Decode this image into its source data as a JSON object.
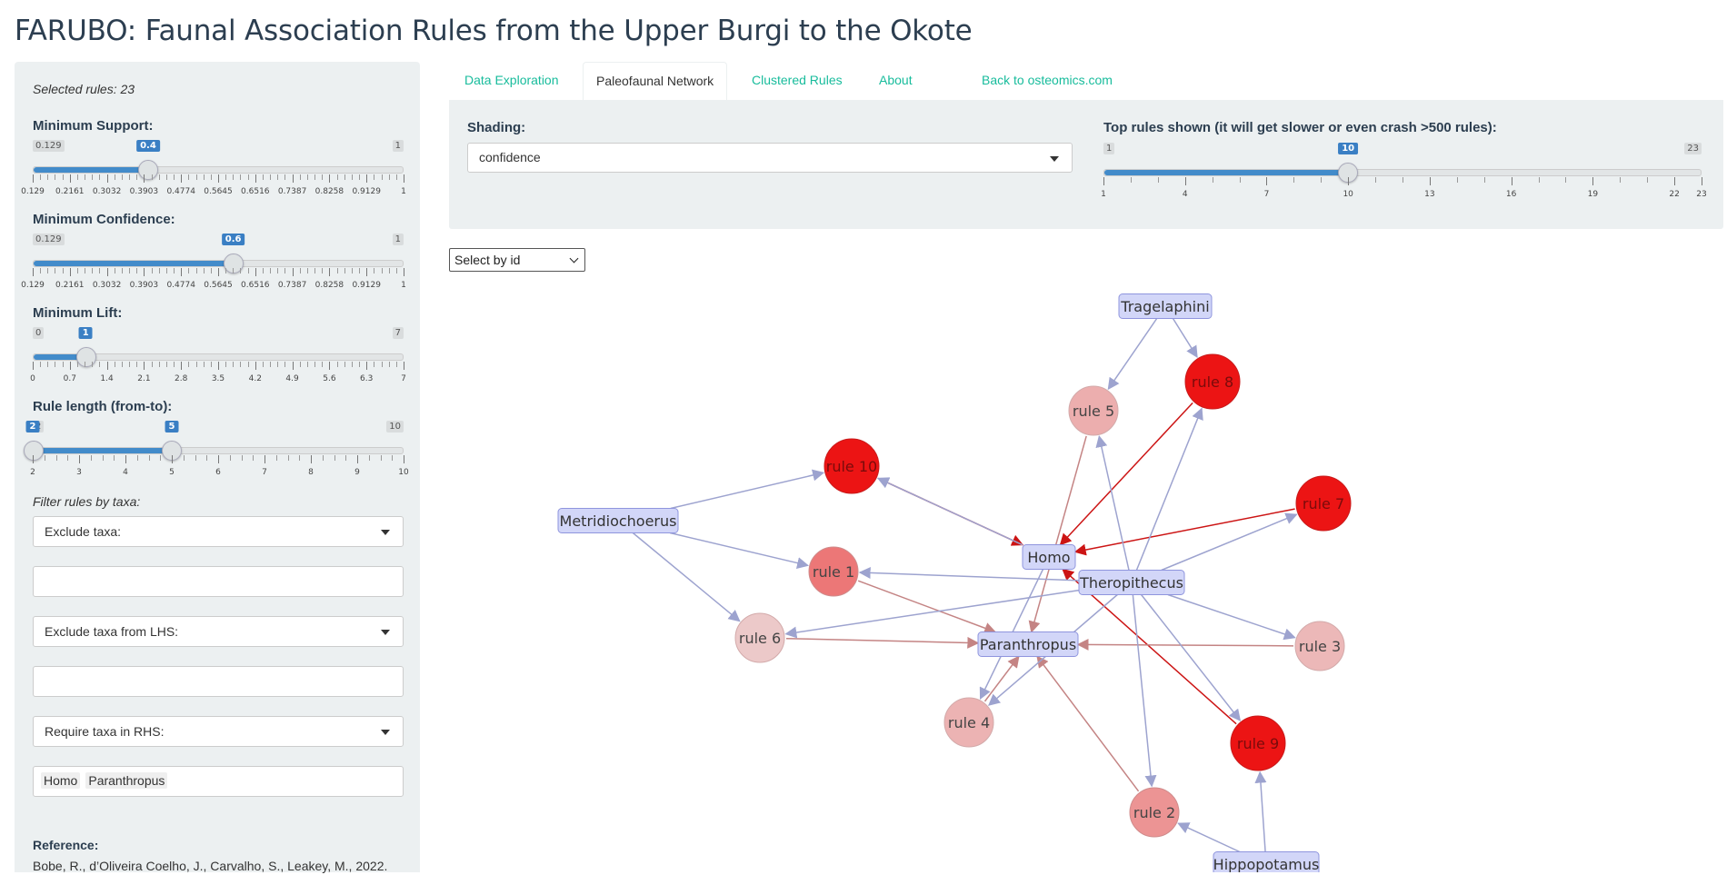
{
  "app_title": "FARUBO: Faunal Association Rules from the Upper Burgi to the Okote",
  "sidebar": {
    "selected_rules": "Selected rules: 23",
    "sliders": {
      "support": {
        "label": "Minimum Support:",
        "min_label": "0.129",
        "max_label": "1",
        "value_label": "0.4",
        "min": 0.129,
        "max": 1,
        "value": 0.4,
        "ticks": [
          "0.129",
          "0.2161",
          "0.3032",
          "0.3903",
          "0.4774",
          "0.5645",
          "0.6516",
          "0.7387",
          "0.8258",
          "0.9129",
          "1"
        ]
      },
      "confidence": {
        "label": "Minimum Confidence:",
        "min_label": "0.129",
        "max_label": "1",
        "value_label": "0.6",
        "min": 0.129,
        "max": 1,
        "value": 0.6,
        "ticks": [
          "0.129",
          "0.2161",
          "0.3032",
          "0.3903",
          "0.4774",
          "0.5645",
          "0.6516",
          "0.7387",
          "0.8258",
          "0.9129",
          "1"
        ]
      },
      "lift": {
        "label": "Minimum Lift:",
        "min_label": "0",
        "max_label": "7",
        "value_label": "1",
        "min": 0,
        "max": 7,
        "value": 1,
        "ticks": [
          "0",
          "0.7",
          "1.4",
          "2.1",
          "2.8",
          "3.5",
          "4.2",
          "4.9",
          "5.6",
          "6.3",
          "7"
        ]
      },
      "rule_length": {
        "label": "Rule length (from-to):",
        "min_label": "2",
        "max_label": "10",
        "from_label": "2",
        "to_label": "5",
        "min": 2,
        "max": 10,
        "from": 2,
        "to": 5,
        "ticks": [
          "2",
          "3",
          "4",
          "5",
          "6",
          "7",
          "8",
          "9",
          "10"
        ]
      }
    },
    "filter_label": "Filter rules by taxa:",
    "exclude_taxa": "Exclude taxa:",
    "exclude_lhs": "Exclude taxa from LHS:",
    "require_rhs": "Require taxa in RHS:",
    "rhs_chips": [
      "Homo",
      "Paranthropus"
    ],
    "reference_label": "Reference:",
    "reference_text": "Bobe, R., d’Oliveira Coelho, J., Carvalho, S., Leakey, M., 2022."
  },
  "tabs": [
    "Data Exploration",
    "Paleofaunal Network",
    "Clustered Rules",
    "About",
    "Back to osteomics.com"
  ],
  "active_tab": "Paleofaunal Network",
  "controls": {
    "shading_label": "Shading:",
    "shading_value": "confidence",
    "top_rules_label": "Top rules shown (it will get slower or even crash >500 rules):",
    "top_rules": {
      "min_label": "1",
      "max_label": "23",
      "value_label": "10",
      "min": 1,
      "max": 23,
      "value": 10,
      "tick_labels": [
        "1",
        "4",
        "7",
        "10",
        "13",
        "16",
        "19",
        "22",
        "23"
      ]
    },
    "select_by_id": "Select by id"
  },
  "network": {
    "colors": {
      "item_fill": "#d2d6f8",
      "item_border": "#8f95de",
      "item_edge": "#9da3cf",
      "strong_edge": "#cc1414",
      "medium_edge": "#c48484"
    },
    "items": [
      {
        "id": "trag",
        "label": "Tragelaphini"
      },
      {
        "id": "metr",
        "label": "Metridiochoerus"
      },
      {
        "id": "homo",
        "label": "Homo"
      },
      {
        "id": "ther",
        "label": "Theropithecus"
      },
      {
        "id": "para",
        "label": "Paranthropus"
      },
      {
        "id": "hipp",
        "label": "Hippopotamus"
      }
    ],
    "rules": [
      {
        "id": "r1",
        "label": "rule 1",
        "confidence": 0.78
      },
      {
        "id": "r2",
        "label": "rule 2",
        "confidence": 0.72
      },
      {
        "id": "r3",
        "label": "rule 3",
        "confidence": 0.65
      },
      {
        "id": "r4",
        "label": "rule 4",
        "confidence": 0.66
      },
      {
        "id": "r5",
        "label": "rule 5",
        "confidence": 0.67
      },
      {
        "id": "r6",
        "label": "rule 6",
        "confidence": 0.62
      },
      {
        "id": "r7",
        "label": "rule 7",
        "confidence": 1.0
      },
      {
        "id": "r8",
        "label": "rule 8",
        "confidence": 1.0
      },
      {
        "id": "r9",
        "label": "rule 9",
        "confidence": 1.0
      },
      {
        "id": "r10",
        "label": "rule 10",
        "confidence": 1.0
      }
    ],
    "edges": [
      {
        "from": "trag",
        "to": "r5"
      },
      {
        "from": "trag",
        "to": "r8"
      },
      {
        "from": "metr",
        "to": "r10"
      },
      {
        "from": "metr",
        "to": "r1"
      },
      {
        "from": "metr",
        "to": "r6"
      },
      {
        "from": "r10",
        "to": "homo"
      },
      {
        "from": "homo",
        "to": "r10"
      },
      {
        "from": "r8",
        "to": "homo"
      },
      {
        "from": "r7",
        "to": "homo"
      },
      {
        "from": "r9",
        "to": "homo"
      },
      {
        "from": "r1",
        "to": "para"
      },
      {
        "from": "r5",
        "to": "para"
      },
      {
        "from": "r3",
        "to": "para"
      },
      {
        "from": "r6",
        "to": "para"
      },
      {
        "from": "r4",
        "to": "para"
      },
      {
        "from": "r2",
        "to": "para"
      },
      {
        "from": "homo",
        "to": "r4"
      },
      {
        "from": "ther",
        "to": "r1"
      },
      {
        "from": "ther",
        "to": "r5"
      },
      {
        "from": "ther",
        "to": "r8"
      },
      {
        "from": "ther",
        "to": "r7"
      },
      {
        "from": "ther",
        "to": "r3"
      },
      {
        "from": "ther",
        "to": "r9"
      },
      {
        "from": "ther",
        "to": "r2"
      },
      {
        "from": "ther",
        "to": "r6"
      },
      {
        "from": "ther",
        "to": "r4"
      },
      {
        "from": "hipp",
        "to": "r9"
      },
      {
        "from": "hipp",
        "to": "r2"
      }
    ]
  }
}
